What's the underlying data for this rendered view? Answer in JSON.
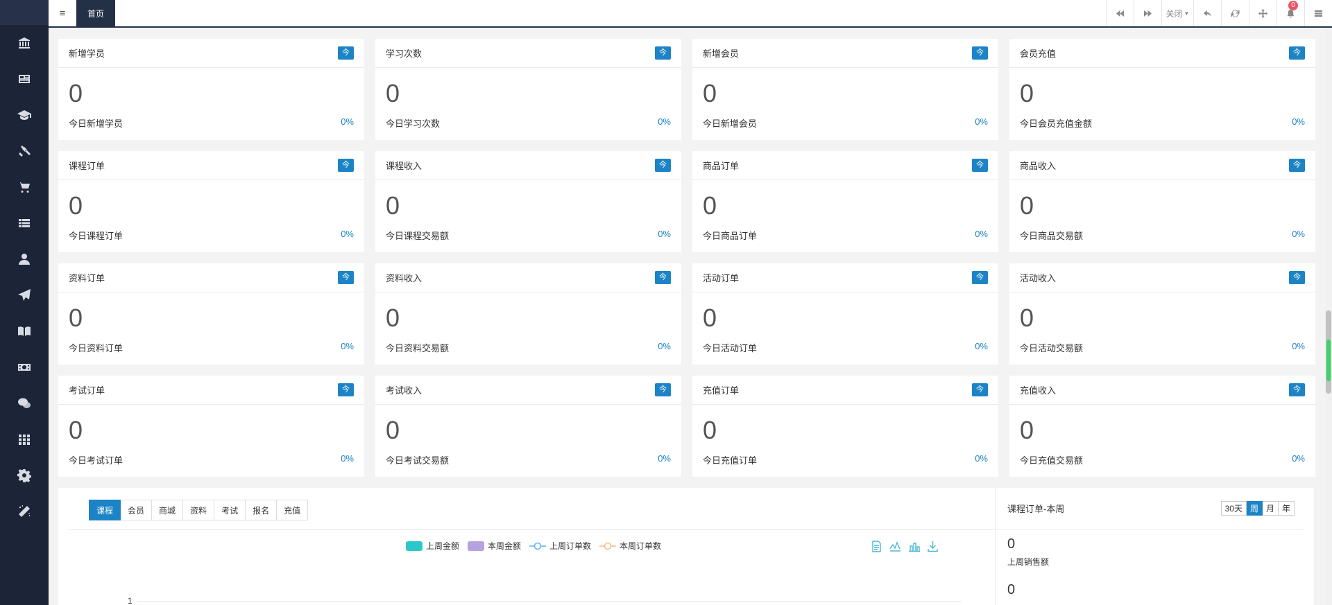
{
  "topbar": {
    "home_tab": "首页",
    "close_label": "关闭",
    "notification_count": "0"
  },
  "sidebar": {
    "items": [
      {
        "icon": "bank-icon"
      },
      {
        "icon": "newspaper-icon"
      },
      {
        "icon": "graduation-cap-icon"
      },
      {
        "icon": "gavel-icon"
      },
      {
        "icon": "cart-icon"
      },
      {
        "icon": "list-icon"
      },
      {
        "icon": "user-icon"
      },
      {
        "icon": "paper-plane-icon"
      },
      {
        "icon": "book-icon"
      },
      {
        "icon": "money-icon"
      },
      {
        "icon": "wechat-icon"
      },
      {
        "icon": "grid-icon"
      },
      {
        "icon": "gear-icon"
      },
      {
        "icon": "magic-wand-icon"
      }
    ]
  },
  "cards": [
    {
      "title": "新增学员",
      "badge": "今",
      "value": "0",
      "subtitle": "今日新增学员",
      "percent": "0%"
    },
    {
      "title": "学习次数",
      "badge": "今",
      "value": "0",
      "subtitle": "今日学习次数",
      "percent": "0%"
    },
    {
      "title": "新增会员",
      "badge": "今",
      "value": "0",
      "subtitle": "今日新增会员",
      "percent": "0%"
    },
    {
      "title": "会员充值",
      "badge": "今",
      "value": "0",
      "subtitle": "今日会员充值金额",
      "percent": "0%"
    },
    {
      "title": "课程订单",
      "badge": "今",
      "value": "0",
      "subtitle": "今日课程订单",
      "percent": "0%"
    },
    {
      "title": "课程收入",
      "badge": "今",
      "value": "0",
      "subtitle": "今日课程交易额",
      "percent": "0%"
    },
    {
      "title": "商品订单",
      "badge": "今",
      "value": "0",
      "subtitle": "今日商品订单",
      "percent": "0%"
    },
    {
      "title": "商品收入",
      "badge": "今",
      "value": "0",
      "subtitle": "今日商品交易额",
      "percent": "0%"
    },
    {
      "title": "资料订单",
      "badge": "今",
      "value": "0",
      "subtitle": "今日资料订单",
      "percent": "0%"
    },
    {
      "title": "资料收入",
      "badge": "今",
      "value": "0",
      "subtitle": "今日资料交易额",
      "percent": "0%"
    },
    {
      "title": "活动订单",
      "badge": "今",
      "value": "0",
      "subtitle": "今日活动订单",
      "percent": "0%"
    },
    {
      "title": "活动收入",
      "badge": "今",
      "value": "0",
      "subtitle": "今日活动交易额",
      "percent": "0%"
    },
    {
      "title": "考试订单",
      "badge": "今",
      "value": "0",
      "subtitle": "今日考试订单",
      "percent": "0%"
    },
    {
      "title": "考试收入",
      "badge": "今",
      "value": "0",
      "subtitle": "今日考试交易额",
      "percent": "0%"
    },
    {
      "title": "充值订单",
      "badge": "今",
      "value": "0",
      "subtitle": "今日充值订单",
      "percent": "0%"
    },
    {
      "title": "充值收入",
      "badge": "今",
      "value": "0",
      "subtitle": "今日充值交易额",
      "percent": "0%"
    }
  ],
  "chart_tabs": [
    "课程",
    "会员",
    "商城",
    "资料",
    "考试",
    "报名",
    "充值"
  ],
  "active_chart_tab": "课程",
  "chart_data": {
    "type": "bar",
    "series": [
      {
        "name": "上周金额",
        "type": "bar",
        "color": "#2ec7c9",
        "values": []
      },
      {
        "name": "本周金额",
        "type": "bar",
        "color": "#b6a2de",
        "values": []
      },
      {
        "name": "上周订单数",
        "type": "line",
        "color": "#5ab1ef",
        "values": []
      },
      {
        "name": "本周订单数",
        "type": "line",
        "color": "#ffb980",
        "values": []
      }
    ],
    "y_ticks": [
      "1"
    ],
    "legend_position": "top-center",
    "grid": true
  },
  "side_panel": {
    "title": "课程订单-本周",
    "periods": [
      "30天",
      "周",
      "月",
      "年"
    ],
    "active_period": "周",
    "stats": [
      {
        "value": "0",
        "label": "上周销售额"
      },
      {
        "value": "0",
        "label": ""
      }
    ]
  },
  "colors": {
    "sidebar_bg": "#1c2438",
    "accent": "#1c84c6",
    "badge": "#ed5565"
  }
}
